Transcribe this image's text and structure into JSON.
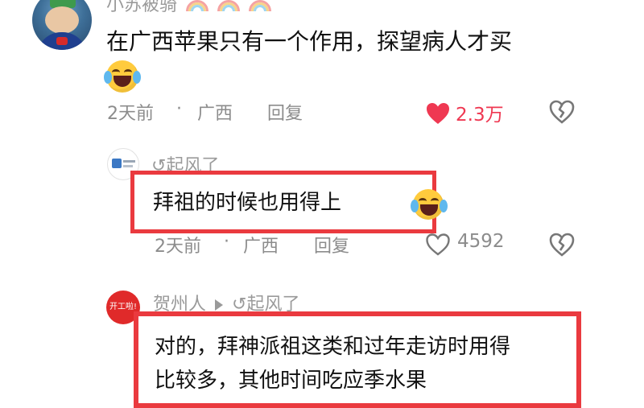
{
  "main_comment": {
    "username": "小苏被骑",
    "text": "在广西苹果只有一个作用，探望病人才买",
    "time": "2天前",
    "separator": "·",
    "location": "广西",
    "reply_label": "回复",
    "likes": "2.3万",
    "liked": true,
    "emoji_icon": "laughing-tears-emoji"
  },
  "reply_1": {
    "username": "↺起风了",
    "text": "拜祖的时候也用得上",
    "time": "2天前",
    "separator": "·",
    "location": "广西",
    "reply_label": "回复",
    "likes": "4592",
    "liked": false
  },
  "reply_2": {
    "username": "贺州人",
    "reply_to": "↺起风了",
    "avatar_text": "开工啦!",
    "text_line1": "对的，拜神派祖这类和过年走访时用得",
    "text_line2": "比较多，其他时间吃应季水果"
  },
  "colors": {
    "accent_red": "#ea3a3f",
    "like_red": "#ef3852",
    "meta_gray": "#8c8c8c"
  }
}
